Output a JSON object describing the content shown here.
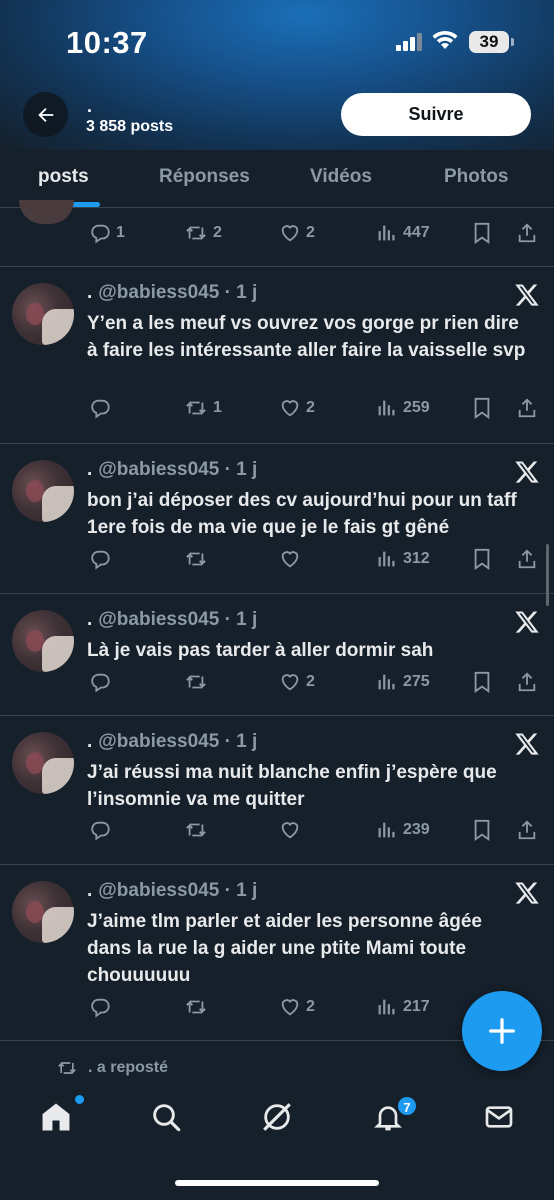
{
  "status_bar": {
    "time": "10:37",
    "battery": "39"
  },
  "header": {
    "name": ".",
    "post_count": "3 858 posts",
    "follow_label": "Suivre"
  },
  "tabs": [
    {
      "label": "posts",
      "active": true
    },
    {
      "label": "Réponses",
      "active": false
    },
    {
      "label": "Vidéos",
      "active": false
    },
    {
      "label": "Photos",
      "active": false
    }
  ],
  "partial_tweet": {
    "replies": "1",
    "reposts": "2",
    "likes": "2",
    "views": "447"
  },
  "tweets": [
    {
      "display_name": ".",
      "handle": "@babiess045",
      "time": "· 1 j",
      "text": "Y’en a les meuf vs ouvrez vos gorge pr rien dire à faire les intéressante aller faire la vaisselle svp",
      "replies": "",
      "reposts": "1",
      "likes": "2",
      "views": "259"
    },
    {
      "display_name": ".",
      "handle": "@babiess045",
      "time": "· 1 j",
      "text": "bon j’ai déposer des cv aujourd’hui pour un taff 1ere fois de ma vie que je le fais gt gêné",
      "replies": "",
      "reposts": "",
      "likes": "",
      "views": "312"
    },
    {
      "display_name": ".",
      "handle": "@babiess045",
      "time": "· 1 j",
      "text": "Là je vais pas tarder à aller dormir sah",
      "replies": "",
      "reposts": "",
      "likes": "2",
      "views": "275"
    },
    {
      "display_name": ".",
      "handle": "@babiess045",
      "time": "· 1 j",
      "text": "J’ai réussi ma nuit blanche enfin j’espère que l’insomnie va me quitter",
      "replies": "",
      "reposts": "",
      "likes": "",
      "views": "239"
    },
    {
      "display_name": ".",
      "handle": "@babiess045",
      "time": "· 1 j",
      "text": "J’aime tlm parler et aider les personne âgée dans la rue la g aider une ptite Mami toute chouuuuuu",
      "replies": "",
      "reposts": "",
      "likes": "2",
      "views": "217"
    }
  ],
  "repost_notice": ". a reposté",
  "bottom_nav": {
    "notification_count": "7"
  },
  "colors": {
    "background": "#15202b",
    "accent": "#1d9bf0",
    "muted": "#8b98a5",
    "text": "#e7e9ea"
  }
}
